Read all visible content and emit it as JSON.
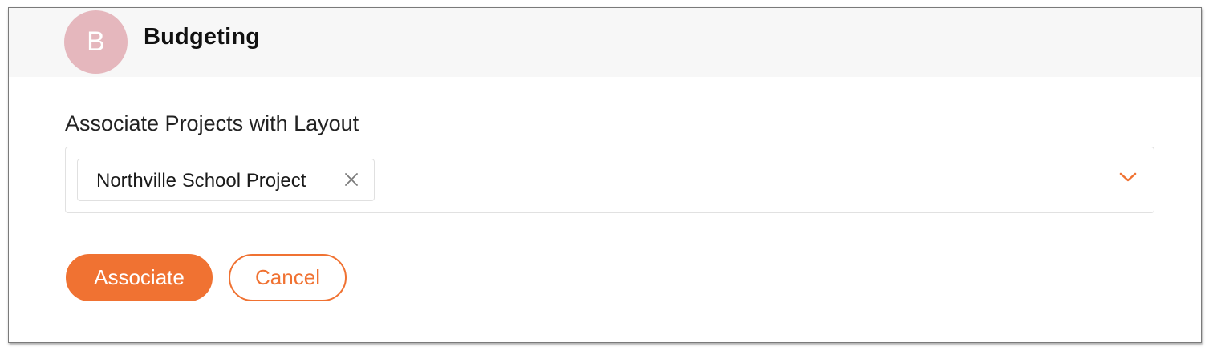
{
  "header": {
    "avatar_letter": "B",
    "title": "Budgeting"
  },
  "form": {
    "label": "Associate Projects with Layout",
    "selected_projects": [
      {
        "label": "Northville School Project"
      }
    ],
    "icons": {
      "chip_remove": "close-icon",
      "dropdown": "chevron-down-icon"
    }
  },
  "actions": {
    "associate_label": "Associate",
    "cancel_label": "Cancel"
  },
  "colors": {
    "accent": "#f07232",
    "avatar_bg": "#e5b7bd",
    "header_bg": "#f7f7f7"
  }
}
